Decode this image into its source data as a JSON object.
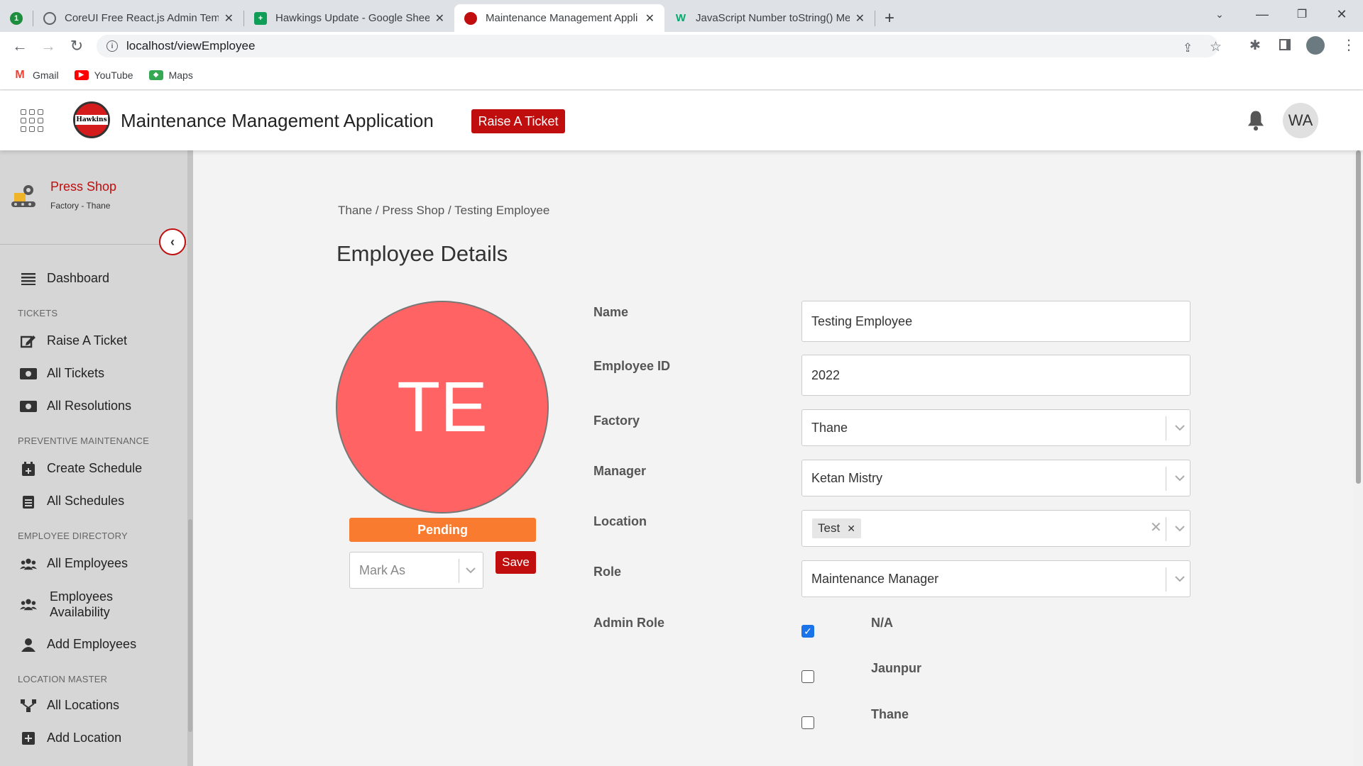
{
  "browser": {
    "tabs": [
      {
        "title": "",
        "favicon_color": "#1e8e3e"
      },
      {
        "title": "CoreUI Free React.js Admin Temp",
        "favicon_color": "#5f6368"
      },
      {
        "title": "Hawkings Update - Google Sheet",
        "favicon_color": "#0f9d58"
      },
      {
        "title": "Maintenance Management Appli",
        "favicon_color": "#c00d0d"
      },
      {
        "title": "JavaScript Number toString() Me",
        "favicon_color": "#04aa6d"
      }
    ],
    "url": "localhost/viewEmployee",
    "bookmarks": [
      {
        "label": "Gmail",
        "color": "#ea4335"
      },
      {
        "label": "YouTube",
        "color": "#ff0000"
      },
      {
        "label": "Maps",
        "color": "#34a853"
      }
    ]
  },
  "header": {
    "logo_text": "Hawkins",
    "app_title": "Maintenance Management Application",
    "raise_ticket": "Raise A Ticket",
    "user_initials": "WA"
  },
  "sidebar": {
    "shop_name": "Press Shop",
    "shop_sub": "Factory - Thane",
    "dashboard": "Dashboard",
    "sections": {
      "tickets": "TICKETS",
      "preventive": "PREVENTIVE MAINTENANCE",
      "employee_dir": "EMPLOYEE DIRECTORY",
      "location_master": "LOCATION MASTER"
    },
    "items": {
      "raise_ticket": "Raise A Ticket",
      "all_tickets": "All Tickets",
      "all_resolutions": "All Resolutions",
      "create_schedule": "Create Schedule",
      "all_schedules": "All Schedules",
      "all_employees": "All Employees",
      "emp_avail_1": "Employees",
      "emp_avail_2": "Availability",
      "add_employees": "Add Employees",
      "all_locations": "All Locations",
      "add_location": "Add Location"
    }
  },
  "main": {
    "breadcrumb": "Thane / Press Shop / Testing Employee",
    "title": "Employee Details",
    "avatar_initials": "TE",
    "status": "Pending",
    "mark_as_placeholder": "Mark As",
    "save": "Save",
    "fields": {
      "name_label": "Name",
      "name_value": "Testing Employee",
      "empid_label": "Employee ID",
      "empid_value": "2022",
      "factory_label": "Factory",
      "factory_value": "Thane",
      "manager_label": "Manager",
      "manager_value": "Ketan Mistry",
      "location_label": "Location",
      "location_tag": "Test",
      "role_label": "Role",
      "role_value": "Maintenance Manager",
      "admin_role_label": "Admin Role"
    },
    "admin_roles": [
      {
        "label": "N/A",
        "checked": true
      },
      {
        "label": "Jaunpur",
        "checked": false
      },
      {
        "label": "Thane",
        "checked": false
      }
    ]
  }
}
